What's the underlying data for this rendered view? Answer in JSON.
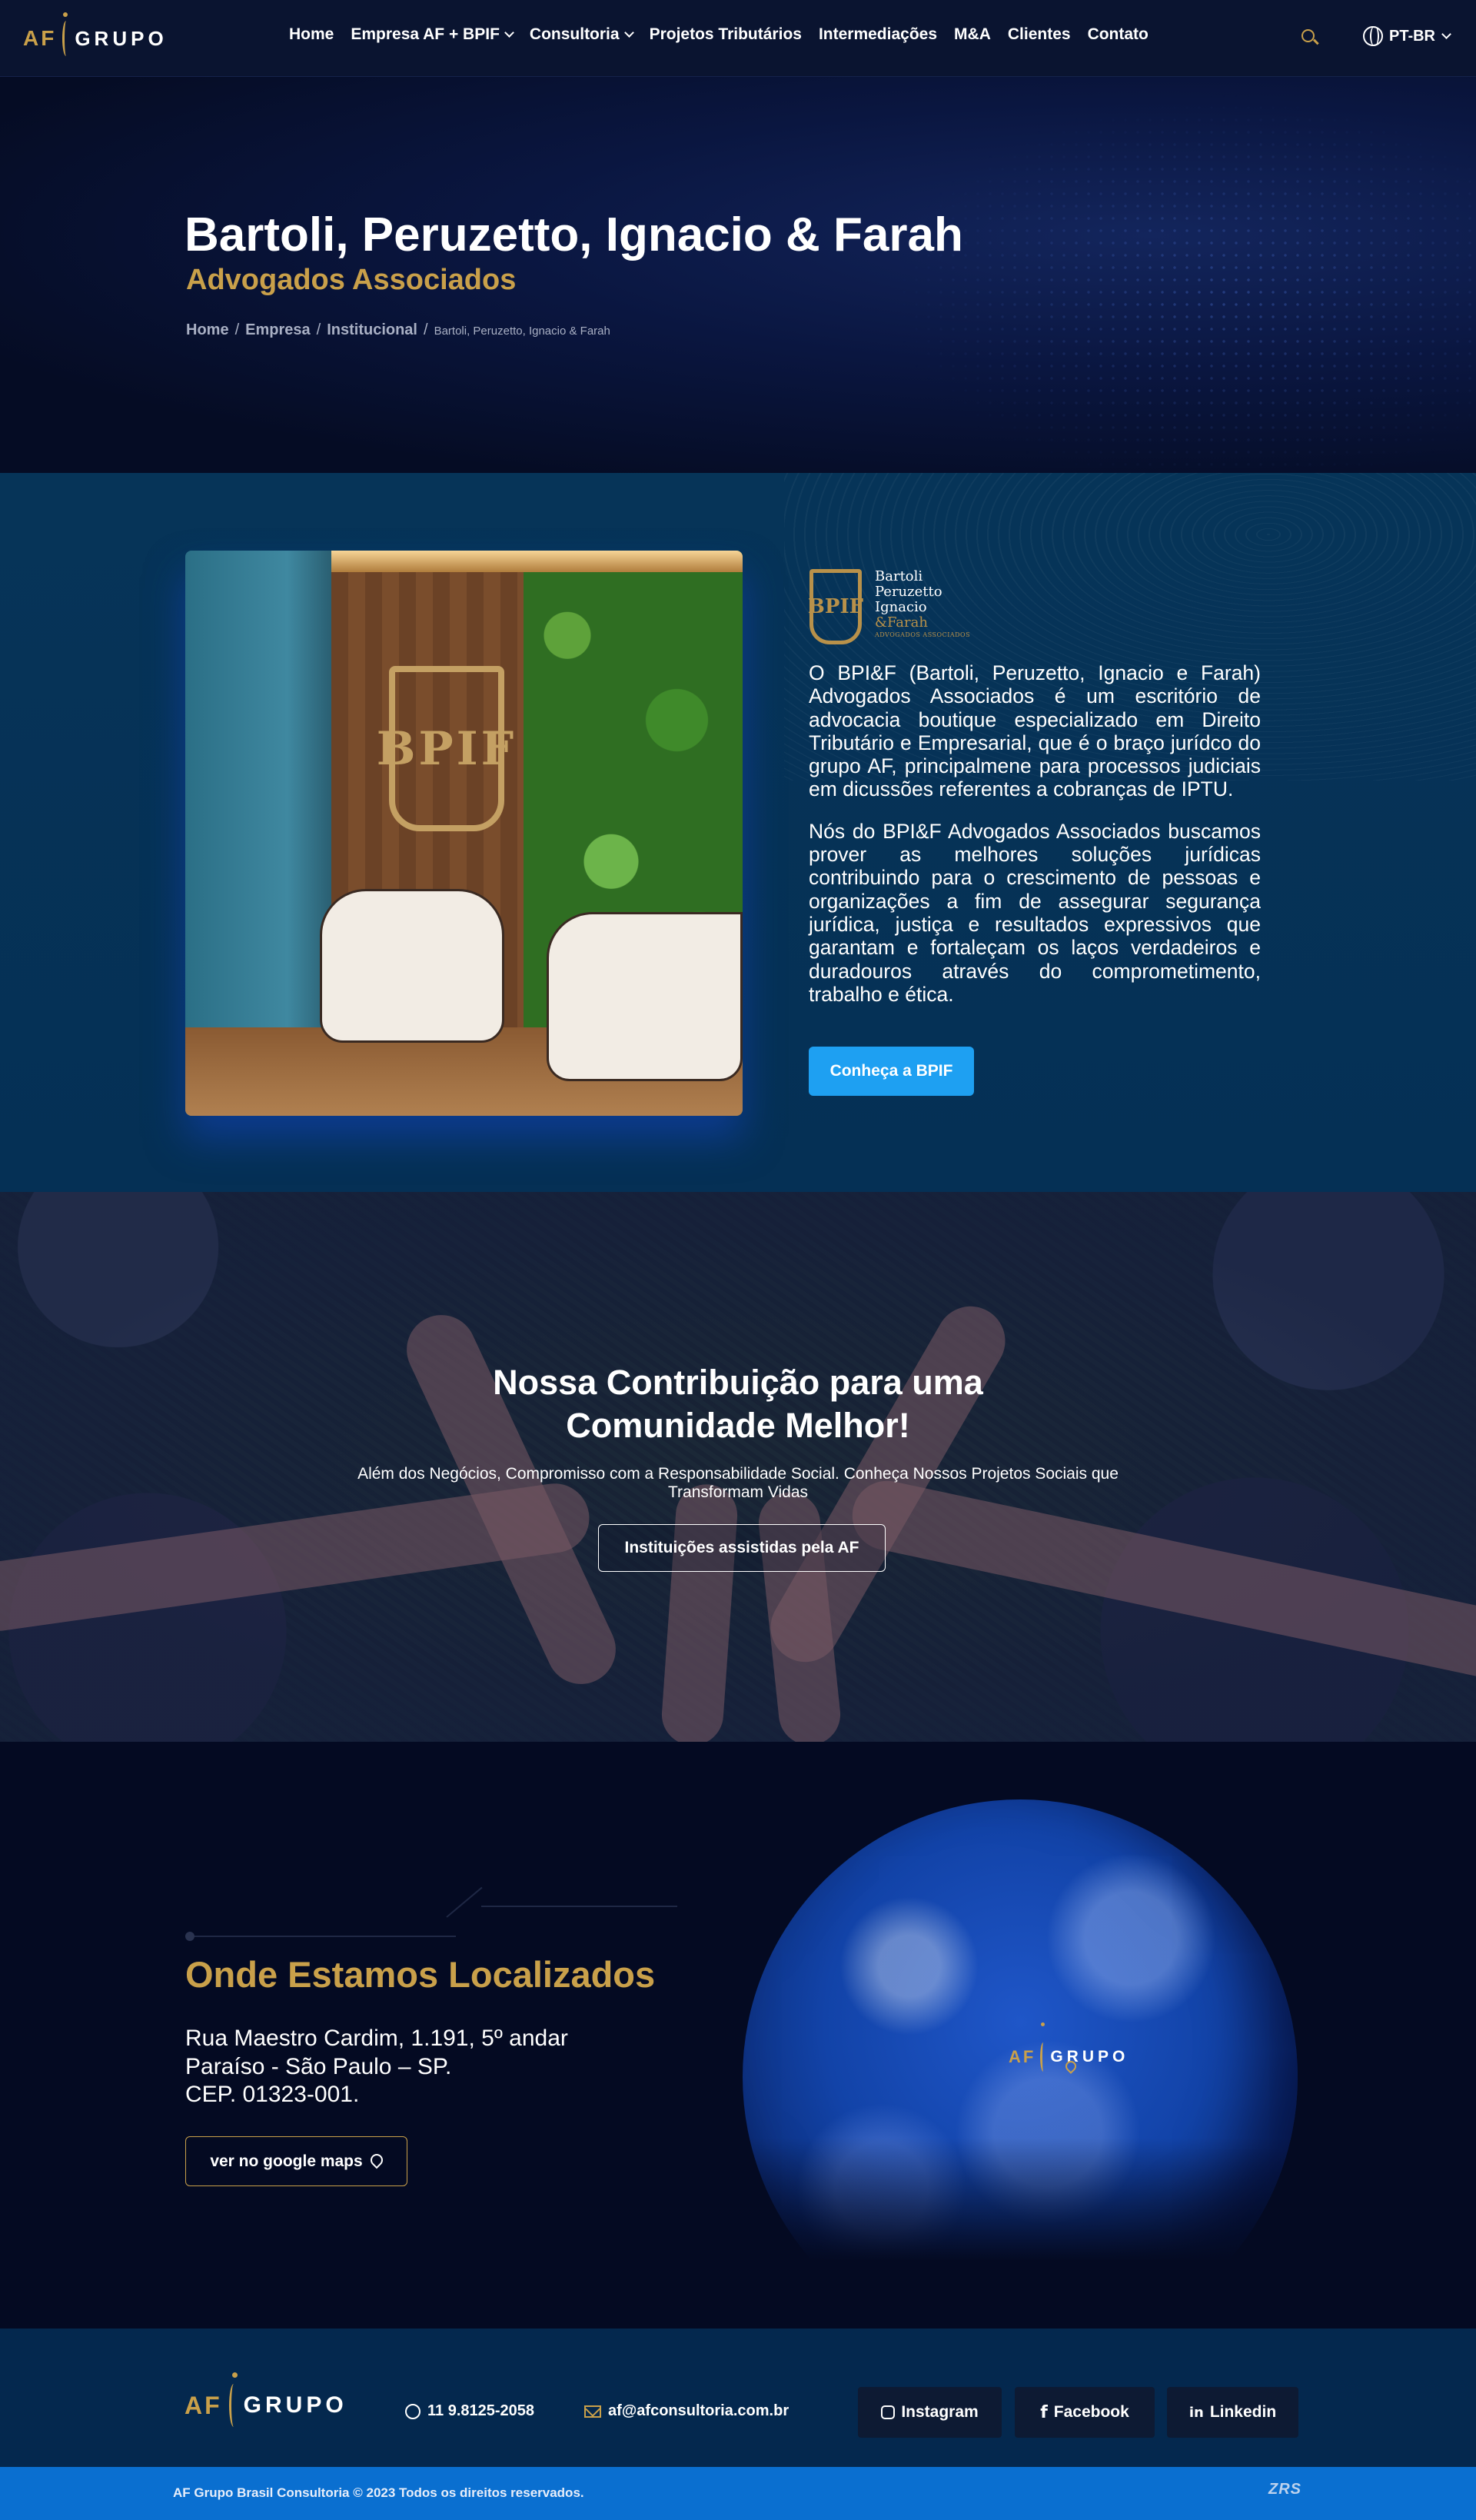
{
  "brand": {
    "logo_af": "AF",
    "logo_grupo": "GRUPO"
  },
  "nav": {
    "items": [
      {
        "label": "Home"
      },
      {
        "label": "Empresa AF + BPIF"
      },
      {
        "label": "Consultoria"
      },
      {
        "label": "Projetos Tributários"
      },
      {
        "label": "Intermediações"
      },
      {
        "label": "M&A"
      },
      {
        "label": "Clientes"
      },
      {
        "label": "Contato"
      }
    ],
    "language": "PT-BR"
  },
  "hero": {
    "title": "Bartoli, Peruzetto, Ignacio & Farah",
    "subtitle": "Advogados Associados",
    "breadcrumb": [
      "Home",
      "Empresa",
      "Institucional"
    ],
    "breadcrumb_current": "Bartoli, Peruzetto, Ignacio & Farah"
  },
  "about": {
    "photo_emblem": "BPIF",
    "logo_mark": "BPIF",
    "logo_lines": [
      "Bartoli",
      "Peruzetto",
      "Ignacio",
      "&Farah"
    ],
    "logo_tag": "ADVOGADOS ASSOCIADOS",
    "paragraph_1": "O BPI&F (Bartoli, Peruzetto, Ignacio e Farah) Advogados Associados é um escritório de advocacia boutique especializado em Direito Tributário e Empresarial, que é o braço jurídco do grupo AF, principalmene para processos judiciais em dicussões referentes a cobranças de IPTU.",
    "paragraph_2": "Nós do BPI&F Advogados Associados buscamos prover as melhores soluções jurídicas contribuindo para o crescimento de pessoas e organizações a fim de assegurar segurança jurídica, justiça e resultados expressivos que garantam e fortaleçam os laços verdadeiros e duradouros através do comprometimento, trabalho e ética.",
    "button": "Conheça a BPIF"
  },
  "contribution": {
    "title": "Nossa Contribuição para uma Comunidade Melhor!",
    "subtitle": "Além dos Negócios, Compromisso com a Responsabilidade Social. Conheça Nossos Projetos Sociais que Transformam Vidas",
    "button": "Instituições assistidas pela AF"
  },
  "location": {
    "title": "Onde Estamos Localizados",
    "address_line_1": "Rua Maestro Cardim, 1.191, 5º andar",
    "address_line_2": "Paraíso - São Paulo – SP.",
    "address_line_3": "CEP. 01323-001.",
    "button": "ver no google maps"
  },
  "footer": {
    "phone": "11 9.8125-2058",
    "email": "af@afconsultoria.com.br",
    "social": [
      "Instagram",
      "Facebook",
      "Linkedin"
    ],
    "copyright": "AF Grupo Brasil Consultoria © 2023 Todos os direitos reservados.",
    "credit": "ZRS"
  },
  "colors": {
    "gold": "#c9a04a",
    "button_blue": "#1ea0f2",
    "bottom_bar": "#0a6fd0",
    "navy": "#050c24"
  }
}
